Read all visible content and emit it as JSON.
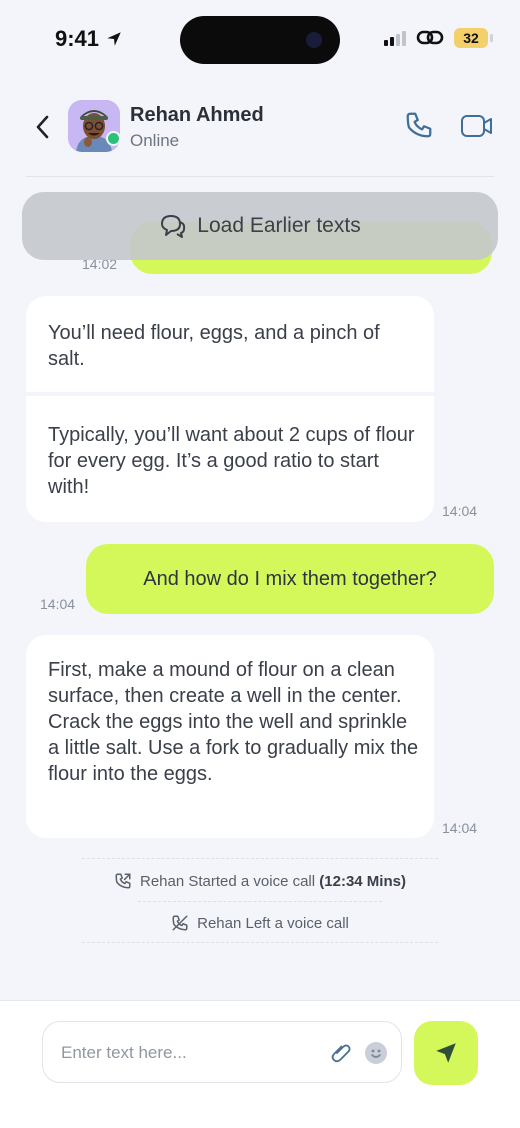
{
  "status_bar": {
    "time": "9:41",
    "battery": "32"
  },
  "header": {
    "contact_name": "Rehan Ahmed",
    "contact_status": "Online"
  },
  "load_earlier": {
    "label": "Load Earlier texts"
  },
  "messages": [
    {
      "direction": "out",
      "partial_time": "14:02"
    },
    {
      "direction": "in",
      "parts": [
        "You’ll need flour, eggs, and a pinch of salt.",
        "Typically, you’ll want about 2 cups of flour for every egg. It’s a good ratio to start with!"
      ],
      "time": "14:04"
    },
    {
      "direction": "out",
      "text": "And how do I mix them together?",
      "time": "14:04"
    },
    {
      "direction": "in",
      "text": "First, make a mound of flour on a clean surface, then create a well in the center. Crack the eggs into the well and sprinkle a little salt. Use a fork to gradually mix the flour into the eggs.",
      "time": "14:04"
    }
  ],
  "system_events": [
    {
      "text": "Rehan Started a voice call",
      "duration": "(12:34 Mins)",
      "icon": "phone-outgoing-icon"
    },
    {
      "text": "Rehan Left a voice call",
      "icon": "phone-off-icon"
    }
  ],
  "composer": {
    "placeholder": "Enter text here..."
  },
  "colors": {
    "accent": "#d4f85a",
    "background": "#f3f5fa",
    "online": "#2cc07b"
  }
}
